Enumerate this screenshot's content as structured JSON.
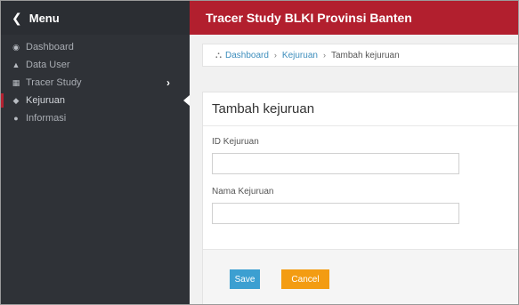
{
  "sidebar": {
    "menu_label": "Menu",
    "items": [
      {
        "label": "Dashboard",
        "icon": "dashboard-icon"
      },
      {
        "label": "Data User",
        "icon": "user-icon"
      },
      {
        "label": "Tracer Study",
        "icon": "table-icon"
      },
      {
        "label": "Kejuruan",
        "icon": "tag-icon"
      },
      {
        "label": "Informasi",
        "icon": "globe-icon"
      }
    ]
  },
  "header": {
    "title": "Tracer Study BLKI Provinsi Banten"
  },
  "breadcrumb": {
    "home": "Dashboard",
    "level2": "Kejuruan",
    "current": "Tambah kejuruan"
  },
  "form": {
    "title": "Tambah kejuruan",
    "id_label": "ID Kejuruan",
    "id_value": "",
    "nama_label": "Nama Kejuruan",
    "nama_value": "",
    "save_label": "Save",
    "cancel_label": "Cancel"
  },
  "colors": {
    "accent_red": "#b21f2e",
    "sidebar_bg": "#2f3237",
    "save_blue": "#3c9fd1",
    "cancel_orange": "#f39c12"
  }
}
